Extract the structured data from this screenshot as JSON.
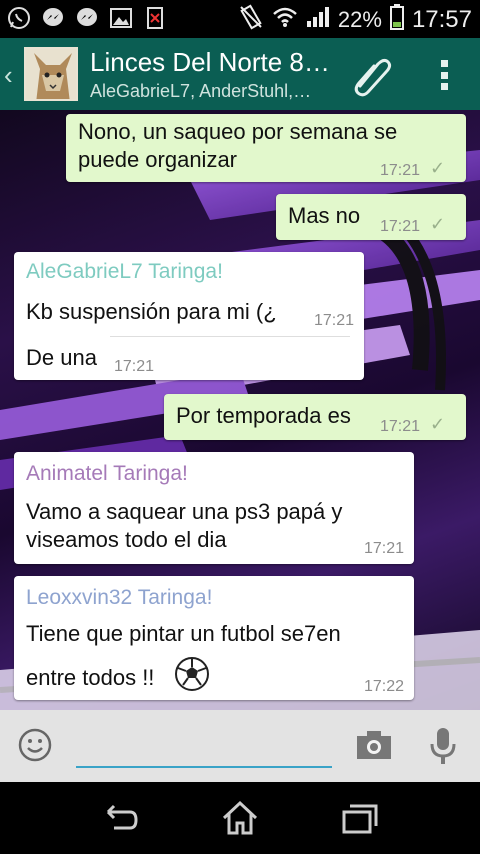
{
  "status_bar": {
    "battery": "22%",
    "clock": "17:57",
    "icons": [
      "whatsapp-icon",
      "messenger-icon",
      "messenger-icon",
      "gallery-icon",
      "sim-icon",
      "vibrate-icon",
      "wifi-icon",
      "signal-icon",
      "battery-icon"
    ]
  },
  "header": {
    "title": "Linces Del Norte  8…",
    "subtitle": "AleGabrieL7, AnderStuhl,…"
  },
  "messages": [
    {
      "type": "out",
      "text_line1": "Nono, un saqueo por semana se",
      "text_line2": "puede organizar",
      "time": "17:21"
    },
    {
      "type": "out",
      "text": "Mas no",
      "time": "17:21"
    },
    {
      "type": "in",
      "sender": "AleGabrieL7 Taringa!",
      "sender_color": "#7ecbc0",
      "text1": "Kb suspensión para mi (¿",
      "time1": "17:21",
      "text2": "De una",
      "time2": "17:21"
    },
    {
      "type": "out",
      "text": "Por temporada es",
      "time": "17:21"
    },
    {
      "type": "in",
      "sender": "Animatel Taringa!",
      "sender_color": "#a57ab8",
      "text_line1": "Vamo a saquear una ps3 papá y",
      "text_line2": "viseamos todo el dia",
      "time": "17:21"
    },
    {
      "type": "in",
      "sender": "Leoxxvin32 Taringa!",
      "sender_color": "#8ea3cf",
      "text_line1": "Tiene que pintar un futbol se7en",
      "text_line2": "entre todos !!",
      "time": "17:22"
    }
  ],
  "colors": {
    "header_bg": "#0b5e53",
    "outgoing_bubble": "#e2f8cc",
    "incoming_bubble": "#ffffff",
    "input_underline": "#3aa3c7"
  }
}
